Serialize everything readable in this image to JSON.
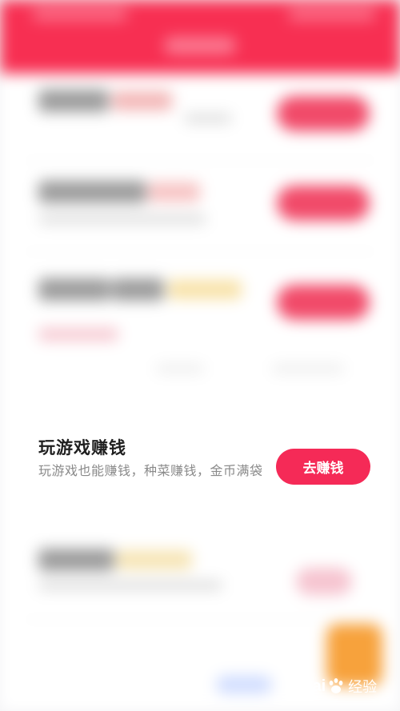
{
  "card": {
    "title": "玩游戏赚钱",
    "description": "玩游戏也能赚钱，种菜赚钱，金币满袋",
    "button_label": "去赚钱"
  },
  "watermark": {
    "text_left": "Bai",
    "text_right": "经验",
    "icon": "paw-icon"
  },
  "colors": {
    "header": "#f72f52",
    "accent_button": "#f52a57",
    "fab": "#f7a23c"
  }
}
